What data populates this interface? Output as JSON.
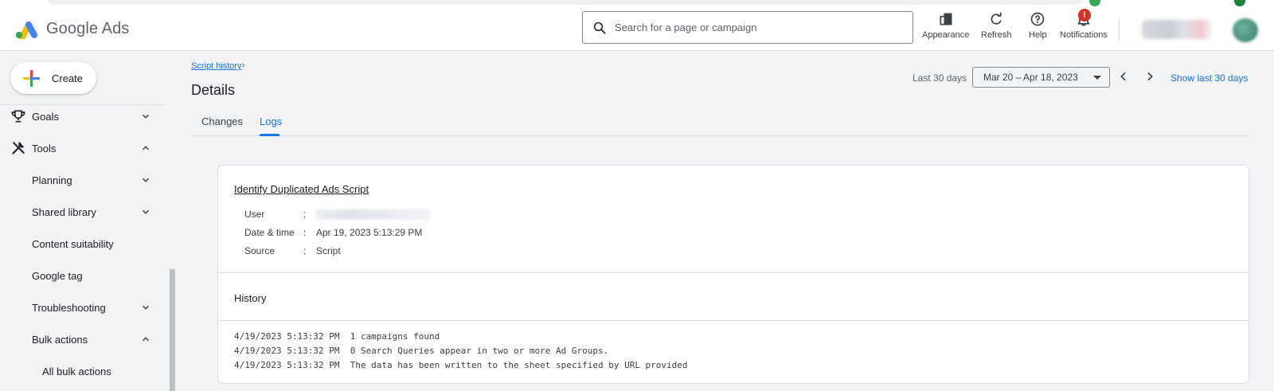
{
  "app": {
    "name": "Google Ads"
  },
  "search": {
    "placeholder": "Search for a page or campaign"
  },
  "toolbar": [
    {
      "label": "Appearance",
      "icon": "appearance-icon"
    },
    {
      "label": "Refresh",
      "icon": "refresh-icon"
    },
    {
      "label": "Help",
      "icon": "help-icon"
    },
    {
      "label": "Notifications",
      "icon": "bell-icon",
      "badge": "!"
    }
  ],
  "sidebar": {
    "create_label": "Create",
    "items": [
      {
        "label": "Goals",
        "icon": "trophy-icon",
        "chevron": "down"
      },
      {
        "label": "Tools",
        "icon": "tools-icon",
        "chevron": "up"
      },
      {
        "label": "Planning",
        "chevron": "down"
      },
      {
        "label": "Shared library",
        "chevron": "down"
      },
      {
        "label": "Content suitability"
      },
      {
        "label": "Google tag"
      },
      {
        "label": "Troubleshooting",
        "chevron": "down"
      },
      {
        "label": "Bulk actions",
        "chevron": "up"
      },
      {
        "label": "All bulk actions"
      }
    ]
  },
  "breadcrumb": {
    "label": "Script history",
    "separator": "›"
  },
  "page": {
    "title": "Details"
  },
  "date_range": {
    "label": "Last 30 days",
    "value": "Mar 20 – Apr 18, 2023",
    "show_last": "Show last 30 days"
  },
  "tabs": [
    {
      "label": "Changes",
      "active": false
    },
    {
      "label": "Logs",
      "active": true
    }
  ],
  "details": {
    "script_name": "Identify Duplicated Ads Script",
    "rows": [
      {
        "key": "User",
        "value": ""
      },
      {
        "key": "Date & time",
        "value": "Apr 19, 2023 5:13:29 PM"
      },
      {
        "key": "Source",
        "value": "Script"
      }
    ],
    "separator": ":"
  },
  "history": {
    "title": "History",
    "logs": [
      "4/19/2023 5:13:32 PM  1 campaigns found",
      "4/19/2023 5:13:32 PM  0 Search Queries appear in two or more Ad Groups.",
      "4/19/2023 5:13:32 PM  The data has been written to the sheet specified by URL provided"
    ]
  },
  "colors": {
    "accent": "#1a73e8",
    "badge": "#d93025",
    "text": "#202124",
    "muted": "#5f6368"
  }
}
